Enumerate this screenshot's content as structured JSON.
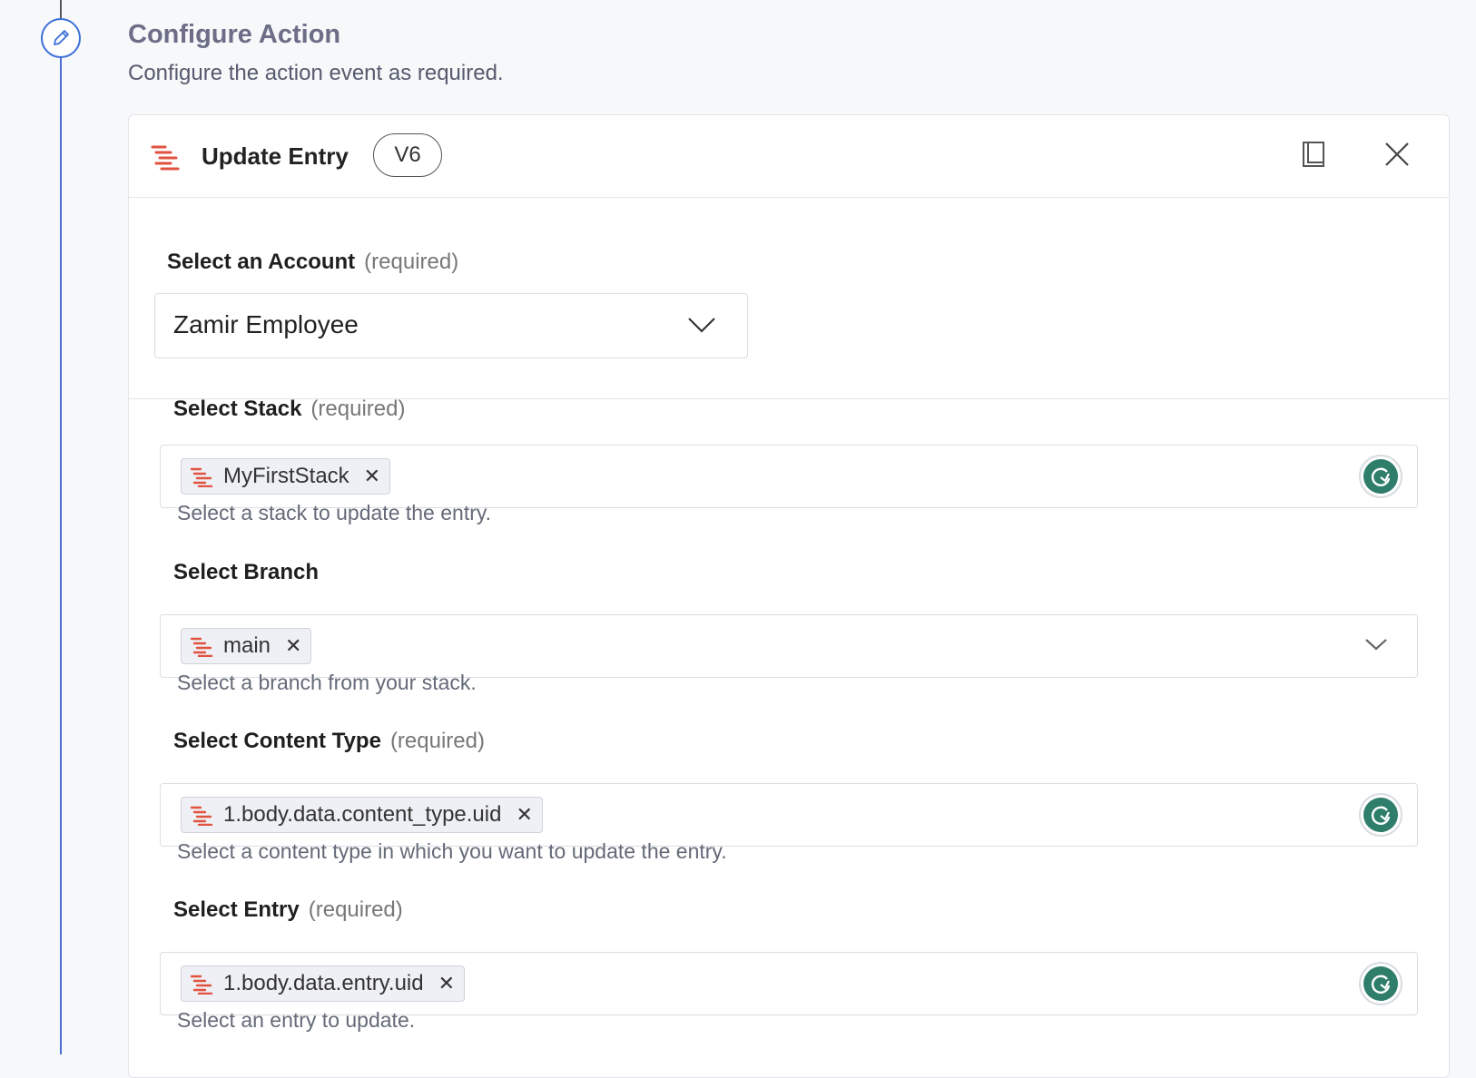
{
  "section": {
    "title": "Configure Action",
    "subtitle": "Configure the action event as required."
  },
  "card": {
    "title": "Update Entry",
    "version": "V6"
  },
  "account": {
    "label": "Select an Account",
    "required": "(required)",
    "value": "Zamir Employee"
  },
  "fields": {
    "stack": {
      "label": "Select Stack",
      "required": "(required)",
      "chip": "MyFirstStack",
      "help": "Select a stack to update the entry."
    },
    "branch": {
      "label": "Select Branch",
      "chip": "main",
      "help": "Select a branch from your stack."
    },
    "content_type": {
      "label": "Select Content Type",
      "required": "(required)",
      "chip": "1.body.data.content_type.uid",
      "help": "Select a content type in which you want to update the entry."
    },
    "entry": {
      "label": "Select Entry",
      "required": "(required)",
      "chip": "1.body.data.entry.uid",
      "help": "Select an entry to update."
    }
  },
  "icons": {
    "step": "pencil-icon",
    "app_logo": "contentstack-logo",
    "docs": "book-icon",
    "close": "close-icon",
    "refresh": "refresh-icon"
  },
  "colors": {
    "accent": "#3a6fd8",
    "brand": "#e2533f",
    "refresh": "#2f7d6b"
  }
}
